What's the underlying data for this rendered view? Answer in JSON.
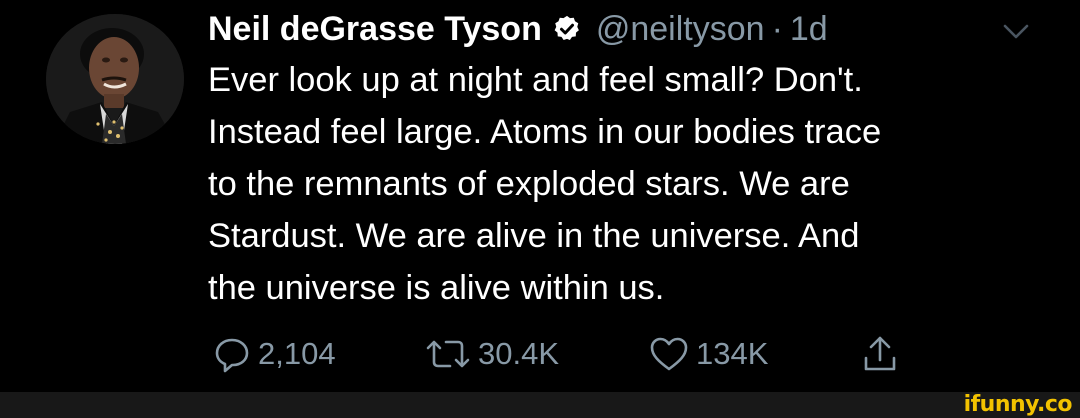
{
  "tweet": {
    "author": {
      "name": "Neil deGrasse Tyson",
      "handle": "@neiltyson",
      "separator": "·",
      "time": "1d",
      "verified": true,
      "avatar_icon": "profile-photo"
    },
    "text_lines": [
      "Ever look up at night and feel small? Don't.",
      "Instead feel large. Atoms in our bodies trace",
      "to the remnants of exploded stars. We are",
      "Stardust. We are alive in the universe. And",
      "the universe is alive within us."
    ],
    "actions": {
      "reply": {
        "icon": "reply-icon",
        "count": "2,104"
      },
      "retweet": {
        "icon": "retweet-icon",
        "count": "30.4K"
      },
      "like": {
        "icon": "heart-icon",
        "count": "134K"
      },
      "share": {
        "icon": "share-icon"
      }
    },
    "menu_icon": "chevron-down-icon"
  },
  "watermark": {
    "text": "ifunny.co"
  },
  "colors": {
    "background": "#000000",
    "text": "#ffffff",
    "secondary": "#8899a6",
    "verified": "#ffffff",
    "watermark": "#f2c200"
  }
}
